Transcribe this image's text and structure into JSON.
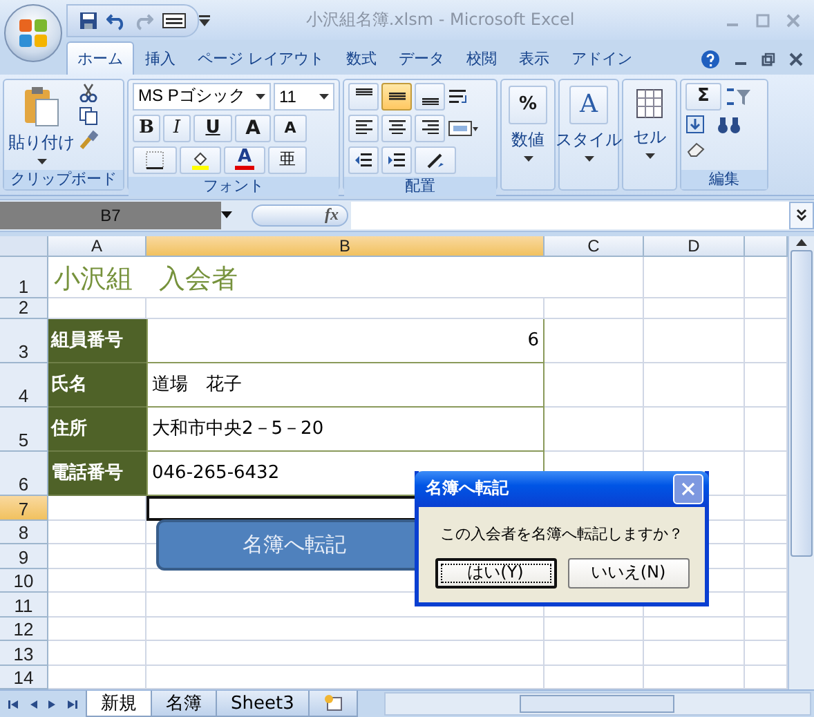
{
  "window": {
    "title": "小沢組名簿.xlsm - Microsoft Excel"
  },
  "ribbon_tabs": [
    {
      "label": "ホーム",
      "selected": true
    },
    {
      "label": "挿入",
      "selected": false
    },
    {
      "label": "ページ レイアウト",
      "selected": false
    },
    {
      "label": "数式",
      "selected": false
    },
    {
      "label": "データ",
      "selected": false
    },
    {
      "label": "校閲",
      "selected": false
    },
    {
      "label": "表示",
      "selected": false
    },
    {
      "label": "アドイン",
      "selected": false
    }
  ],
  "ribbon": {
    "clipboard": {
      "label": "クリップボード",
      "paste": "貼り付け"
    },
    "font": {
      "label": "フォント",
      "font_name": "MS Pゴシック",
      "font_size": "11",
      "bold": "B",
      "italic": "I",
      "underline": "U",
      "grow": "A",
      "shrink": "A",
      "font_color": "A",
      "phonetic": "亜"
    },
    "alignment": {
      "label": "配置",
      "vertical": [
        {
          "kind": "top",
          "selected": false
        },
        {
          "kind": "middle",
          "selected": true
        },
        {
          "kind": "bottom",
          "selected": false
        }
      ]
    },
    "number": {
      "label": "数値",
      "symbol": "%"
    },
    "styles": {
      "label": "スタイル",
      "symbol": "A"
    },
    "cells": {
      "label": "セル"
    },
    "editing": {
      "label": "編集",
      "sum": "Σ"
    }
  },
  "formula_bar": {
    "name_box": "B7",
    "fx": "fx"
  },
  "columns": [
    {
      "label": "A",
      "selected": false
    },
    {
      "label": "B",
      "selected": true
    },
    {
      "label": "C",
      "selected": false
    },
    {
      "label": "D",
      "selected": false
    }
  ],
  "rows": [
    {
      "number": "1",
      "selected": false,
      "kind": "title",
      "text": "小沢組　入会者"
    },
    {
      "number": "2",
      "selected": false,
      "kind": "empty"
    },
    {
      "number": "3",
      "selected": false,
      "kind": "field_number",
      "label": "組員番号",
      "value": "6"
    },
    {
      "number": "4",
      "selected": false,
      "kind": "field",
      "label": "氏名",
      "value": "道場　花子"
    },
    {
      "number": "5",
      "selected": false,
      "kind": "field",
      "label": "住所",
      "value": "大和市中央2－5－20"
    },
    {
      "number": "6",
      "selected": false,
      "kind": "field",
      "label": "電話番号",
      "value": "046-265-6432"
    },
    {
      "number": "7",
      "selected": true,
      "kind": "empty"
    },
    {
      "number": "8",
      "selected": false,
      "kind": "empty"
    },
    {
      "number": "9",
      "selected": false,
      "kind": "empty"
    },
    {
      "number": "10",
      "selected": false,
      "kind": "empty"
    },
    {
      "number": "11",
      "selected": false,
      "kind": "empty"
    },
    {
      "number": "12",
      "selected": false,
      "kind": "empty"
    },
    {
      "number": "13",
      "selected": false,
      "kind": "empty"
    },
    {
      "number": "14",
      "selected": false,
      "kind": "empty"
    }
  ],
  "macro_button": {
    "label": "名簿へ転記"
  },
  "dialog": {
    "title": "名簿へ転記",
    "message": "この入会者を名簿へ転記しますか？",
    "buttons": [
      {
        "label": "はい(Y)",
        "selected": true
      },
      {
        "label": "いいえ(N)",
        "selected": false
      }
    ]
  },
  "sheet_tabs": [
    {
      "label": "新規",
      "selected": true
    },
    {
      "label": "名簿",
      "selected": false
    },
    {
      "label": "Sheet3",
      "selected": false
    }
  ]
}
